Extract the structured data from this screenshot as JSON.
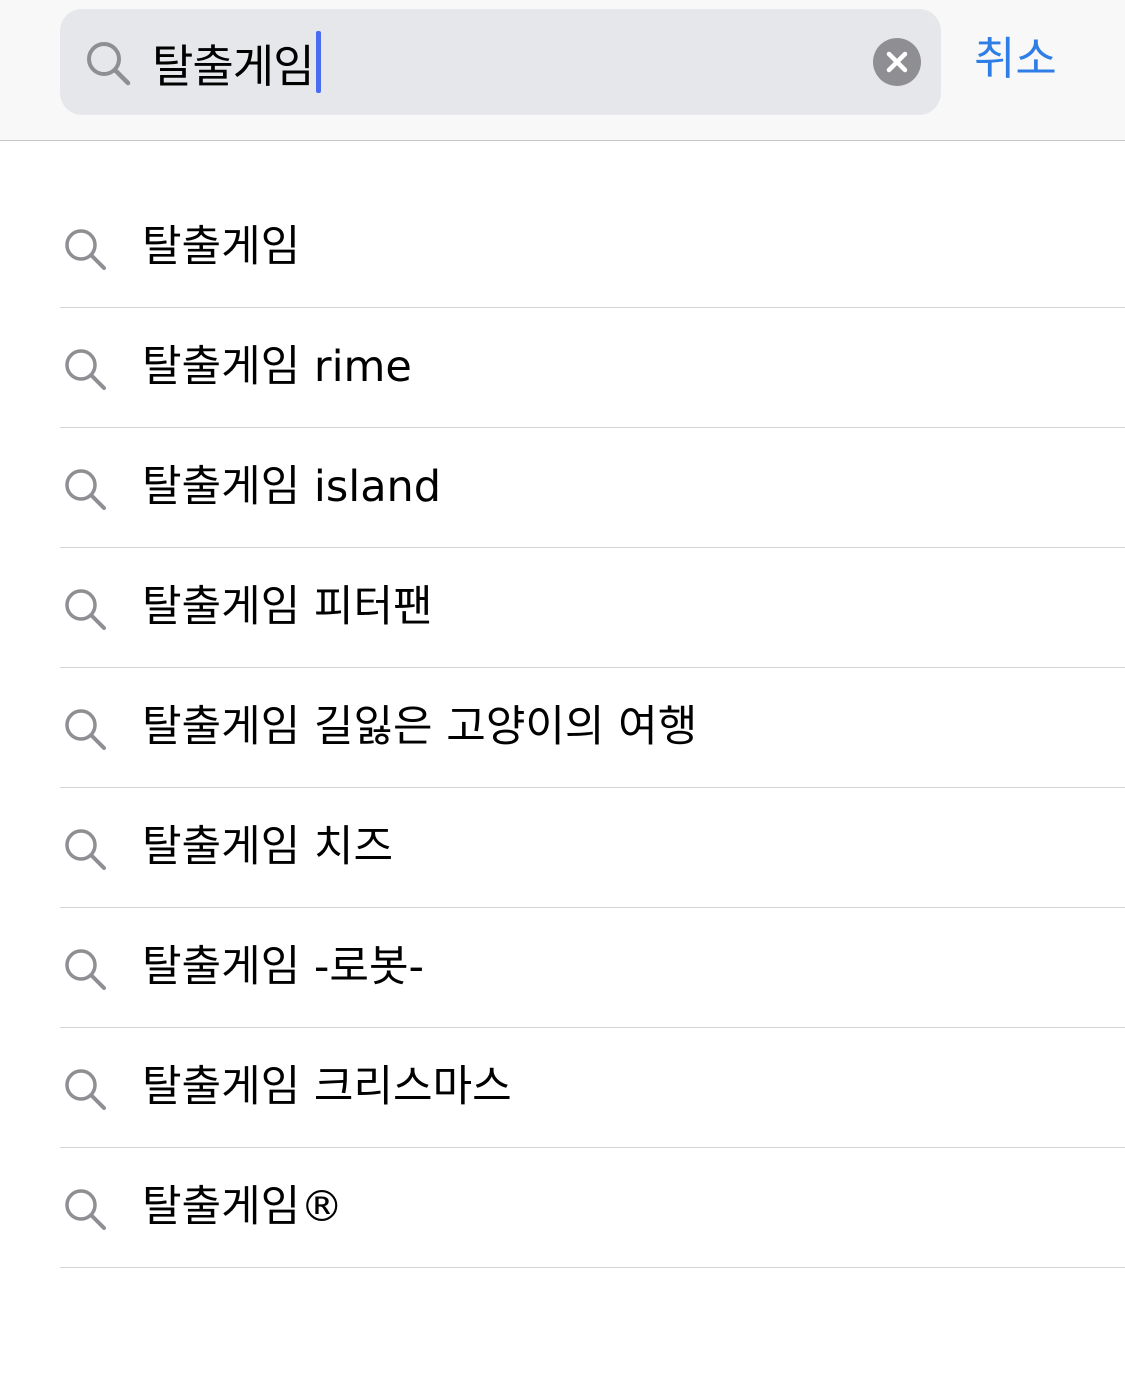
{
  "search": {
    "query": "탈출게임",
    "cancel_label": "취소"
  },
  "suggestions": [
    {
      "label": "탈출게임"
    },
    {
      "label": "탈출게임 rime"
    },
    {
      "label": "탈출게임 island"
    },
    {
      "label": "탈출게임 피터팬"
    },
    {
      "label": "탈출게임 길잃은 고양이의 여행"
    },
    {
      "label": "탈출게임 치즈"
    },
    {
      "label": "탈출게임 -로봇-"
    },
    {
      "label": "탈출게임 크리스마스"
    },
    {
      "label": "탈출게임®"
    }
  ],
  "icons": {
    "search": "search-icon",
    "clear": "clear-icon"
  },
  "colors": {
    "accent": "#2f7ee5",
    "caret": "#4a6cf0",
    "search_field_bg": "#e6e7ea",
    "icon_gray": "#8e8e93"
  }
}
